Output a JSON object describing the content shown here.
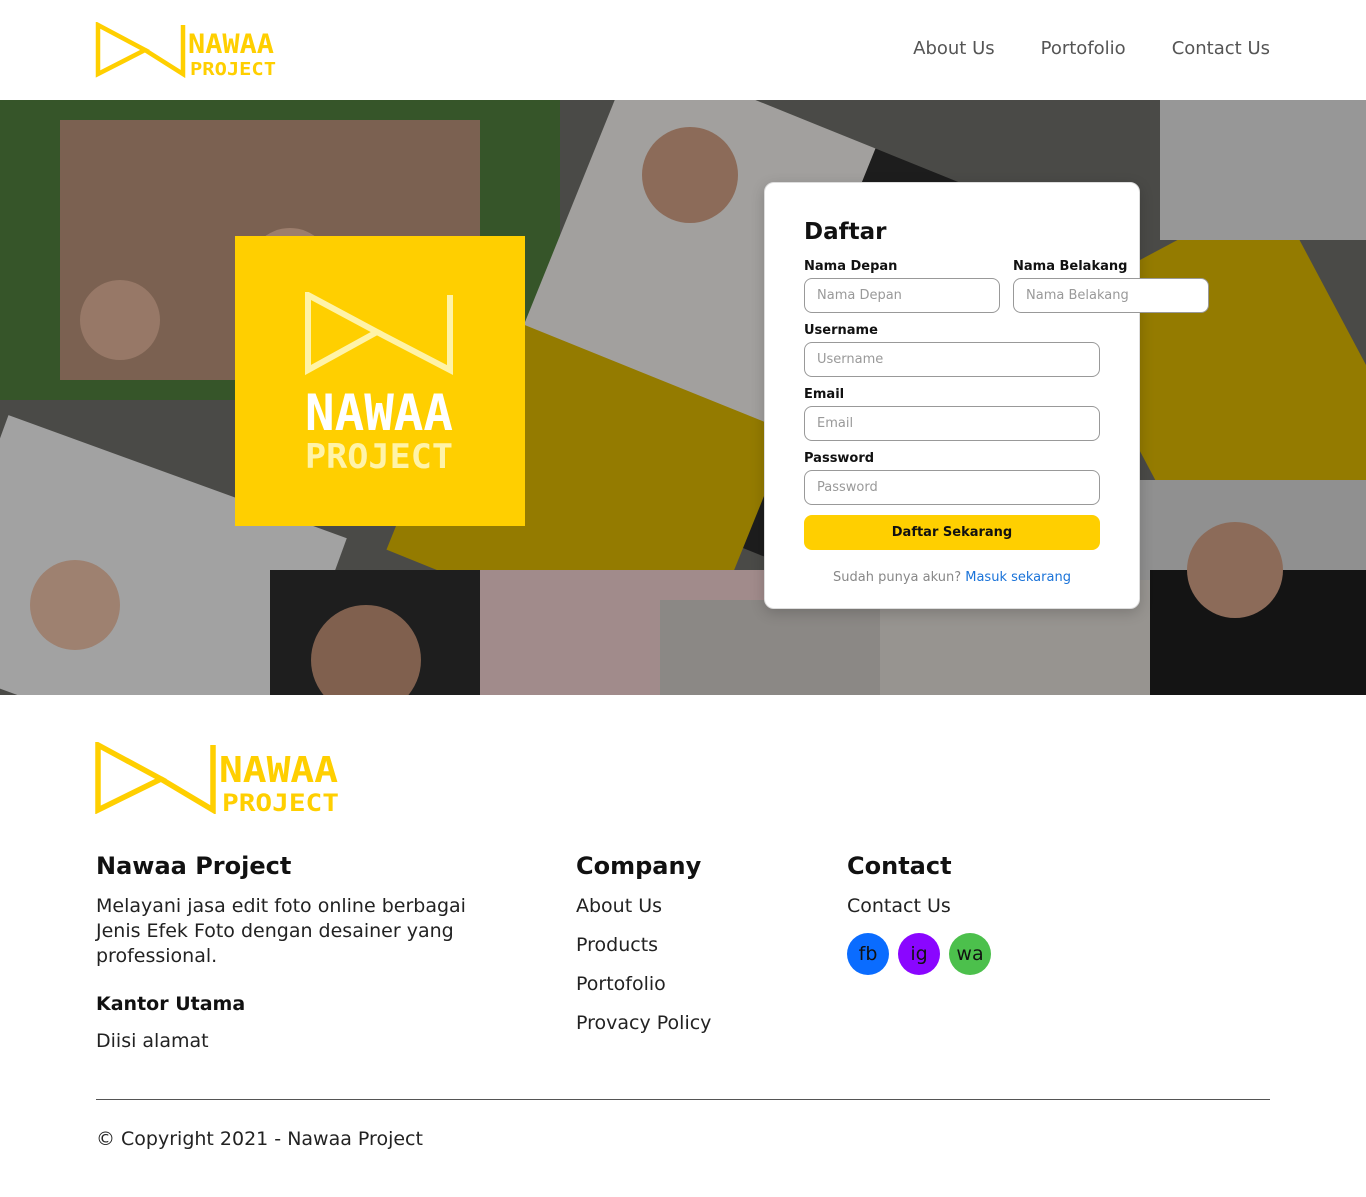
{
  "brand": {
    "logo_word1": "NAWAA",
    "logo_word2": "PROJECT",
    "accent_color": "#ffcf00"
  },
  "nav": {
    "items": [
      "About Us",
      "Portofolio",
      "Contact Us"
    ]
  },
  "signup": {
    "title": "Daftar",
    "first_name": {
      "label": "Nama Depan",
      "placeholder": "Nama Depan"
    },
    "last_name": {
      "label": "Nama Belakang",
      "placeholder": "Nama Belakang"
    },
    "username": {
      "label": "Username",
      "placeholder": "Username"
    },
    "email": {
      "label": "Email",
      "placeholder": "Email"
    },
    "password": {
      "label": "Password",
      "placeholder": "Password"
    },
    "submit_label": "Daftar Sekarang",
    "login_prompt": "Sudah punya akun?",
    "login_link": "Masuk sekarang",
    "link_color": "#1a73d9"
  },
  "footer": {
    "about": {
      "title": "Nawaa Project",
      "description": "Melayani jasa edit foto online berbagai Jenis Efek Foto dengan desainer yang professional.",
      "office_title": "Kantor Utama",
      "office_address": "Diisi alamat"
    },
    "company": {
      "title": "Company",
      "links": [
        "About Us",
        "Products",
        "Portofolio",
        "Provacy Policy"
      ]
    },
    "contact": {
      "title": "Contact",
      "link": "Contact Us",
      "socials": [
        {
          "label": "fb",
          "color": "#0a6cff",
          "icon": "facebook-icon"
        },
        {
          "label": "ig",
          "color": "#8a06ff",
          "icon": "instagram-icon"
        },
        {
          "label": "wa",
          "color": "#4cc04c",
          "icon": "whatsapp-icon"
        }
      ]
    },
    "copyright": "© Copyright 2021 - Nawaa Project"
  }
}
